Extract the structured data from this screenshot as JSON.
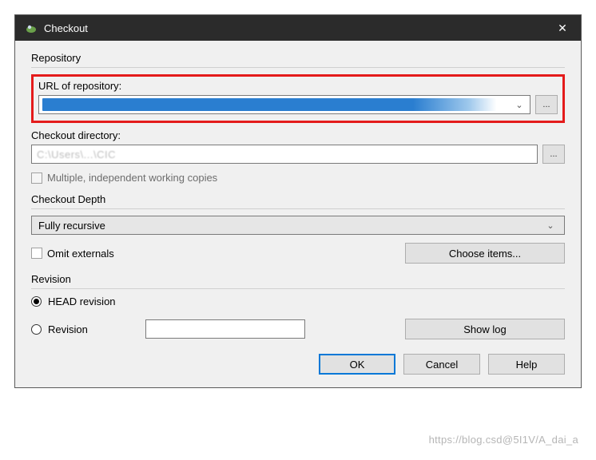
{
  "titlebar": {
    "title": "Checkout",
    "close_label": "✕"
  },
  "repository": {
    "group_label": "Repository",
    "url_label": "URL of repository:",
    "url_value": "",
    "browse_label": "...",
    "dir_label": "Checkout directory:",
    "dir_value": "C:\\Users\\...\\CIC",
    "browse_dir_label": "...",
    "multiple_copies_label": "Multiple, independent working copies",
    "multiple_copies_checked": false
  },
  "depth": {
    "group_label": "Checkout Depth",
    "selected": "Fully recursive",
    "omit_externals_label": "Omit externals",
    "omit_externals_checked": false,
    "choose_items_label": "Choose items..."
  },
  "revision": {
    "group_label": "Revision",
    "head_label": "HEAD revision",
    "revision_label": "Revision",
    "revision_value": "",
    "selected": "head",
    "show_log_label": "Show log"
  },
  "buttons": {
    "ok": "OK",
    "cancel": "Cancel",
    "help": "Help"
  },
  "watermark": "https://blog.csd@5I1V/A_dai_a"
}
